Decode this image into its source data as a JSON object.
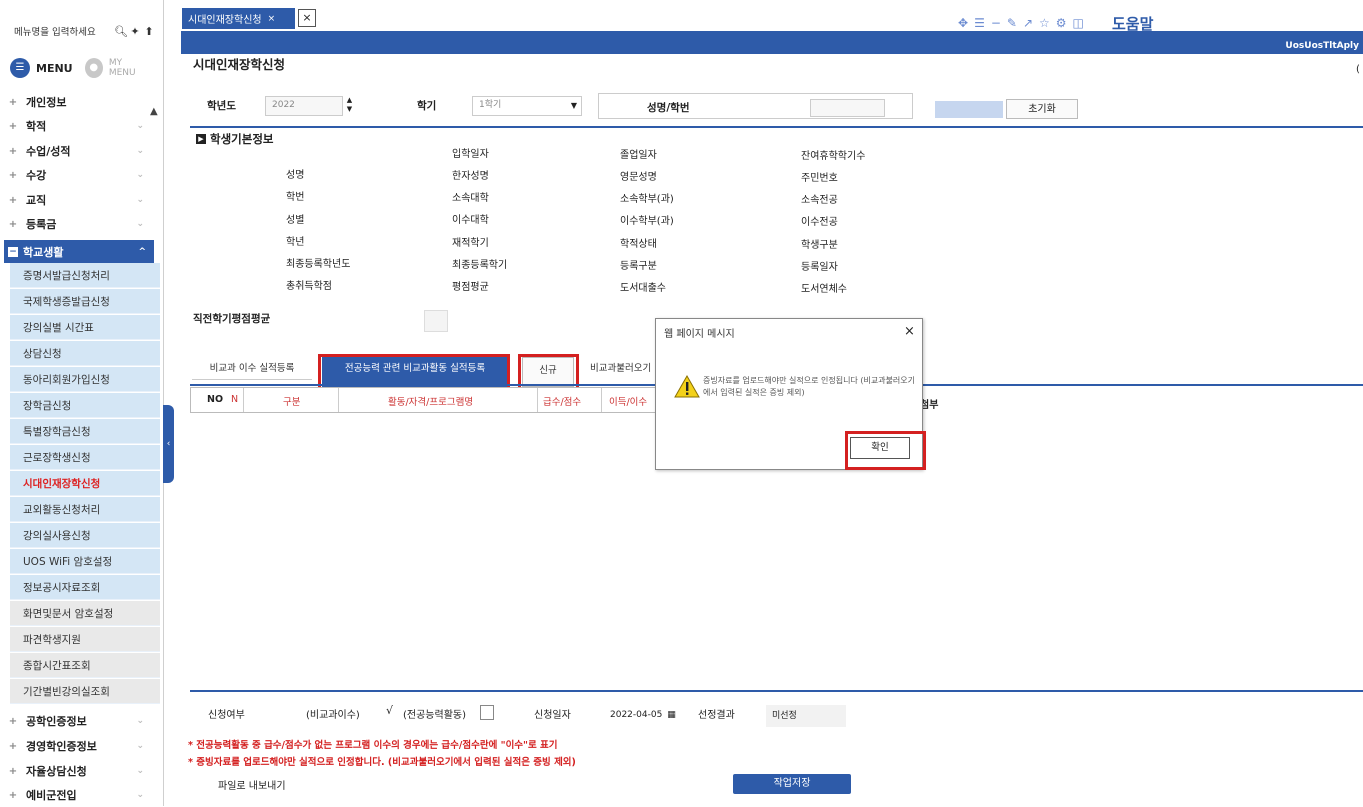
{
  "sidebar": {
    "search_placeholder": "메뉴명을 입력하세요",
    "tab_menu": "MENU",
    "tab_mymenu": "MY MENU",
    "top_items": [
      "개인정보",
      "학적",
      "수업/성적",
      "수강",
      "교직",
      "등록금"
    ],
    "active_group": "학교생활",
    "sub_items": [
      "증명서발급신청처리",
      "국제학생증발급신청",
      "강의실별 시간표",
      "상담신청",
      "동아리회원가입신청",
      "장학금신청",
      "특별장학금신청",
      "근로장학생신청",
      "시대인재장학신청",
      "교외활동신청처리",
      "강의실사용신청",
      "UOS WiFi 암호설정",
      "정보공시자료조회",
      "화면및문서 암호설정",
      "파견학생지원",
      "종합시간표조회",
      "기간별빈강의실조회"
    ],
    "bottom_items": [
      "공학인증정보",
      "경영학인증정보",
      "자율상담신청",
      "예비군전입"
    ]
  },
  "tabs": {
    "active": "시대인재장학신청"
  },
  "header": {
    "help": "도움말",
    "screen_id": "UosUosTltAply",
    "page_title": "시대인재장학신청"
  },
  "search": {
    "year_label": "학년도",
    "year_value": "2022",
    "term_label": "학기",
    "term_value": "1학기",
    "student_label": "성명/학번",
    "reset": "초기화"
  },
  "info": {
    "section_title": "학생기본정보",
    "col1": [
      "성명",
      "학번",
      "성별",
      "학년",
      "최종등록학년도",
      "총취득학점"
    ],
    "col2": [
      "입학일자",
      "한자성명",
      "소속대학",
      "이수대학",
      "재적학기",
      "최종등록학기",
      "평점평균"
    ],
    "col3": [
      "졸업일자",
      "영문성명",
      "소속학부(과)",
      "이수학부(과)",
      "학적상태",
      "등록구분",
      "도서대출수"
    ],
    "col4": [
      "잔여휴학학기수",
      "주민번호",
      "소속전공",
      "이수전공",
      "학생구분",
      "등록일자",
      "도서연체수"
    ],
    "extra": "직전학기평점평균"
  },
  "grid": {
    "tab_nonsubject": "비교과 이수 실적등록",
    "tab_activity": "전공능력 관련 비교과활동 실적등록",
    "btn_new": "신규",
    "tab_load": "비교과불러오기",
    "col_no": "NO",
    "col_n": "N",
    "col_type": "구분",
    "col_program": "활동/자격/프로그램명",
    "col_credit": "급수/점수",
    "col_result": "이득/이수",
    "col_right": "첨부"
  },
  "footer": {
    "apply_status": "신청여부",
    "opt_nonsubject": "(비교과이수)",
    "opt_activity": "(전공능력활동)",
    "apply_date_label": "신청일자",
    "apply_date": "2022-04-05",
    "result_label": "선정결과",
    "result_value": "미선정",
    "note1": "* 전공능력활동 중 급수/점수가 없는 프로그램 이수의 경우에는 급수/점수란에 \"이수\"로 표기",
    "note2": "* 증빙자료를 업로드해야만 실적으로 인정합니다. (비교과불러오기에서 입력된 실적은 증빙 제외)",
    "export": "파일로 내보내기",
    "save": "작업저장"
  },
  "dialog": {
    "title": "웹 페이지 메시지",
    "message": "증빙자료를 업로드해야만 실적으로 인정됩니다 (비교과불러오기에서 입력된 실적은 증빙 제외)",
    "ok": "확인"
  },
  "colors": {
    "accent": "#2e5ba9",
    "highlight": "#d42020",
    "sub_bg": "#d4e6f5"
  }
}
